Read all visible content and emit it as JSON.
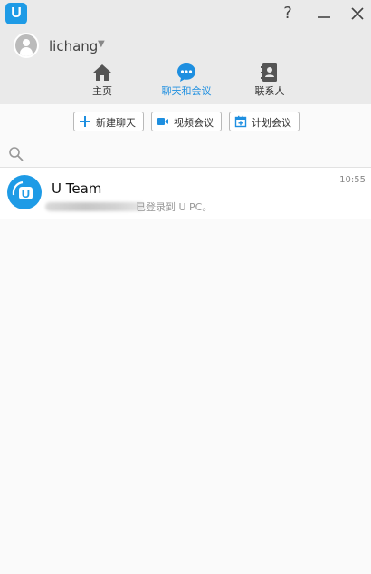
{
  "window": {
    "help_label": "?",
    "minimize_label": "—",
    "close_label": "✕"
  },
  "user": {
    "name": "lichang"
  },
  "nav": {
    "home": "主页",
    "chat": "聊天和会议",
    "contacts": "联系人",
    "active_color": "#1e8fe0"
  },
  "toolbar": {
    "new_chat": "新建聊天",
    "video_meeting": "视频会议",
    "schedule_meeting": "计划会议"
  },
  "search": {
    "placeholder": ""
  },
  "conversations": [
    {
      "name": "U Team",
      "time": "10:55",
      "preview": "已登录到 U PC。"
    }
  ],
  "colors": {
    "brand": "#1e9be6",
    "text_gray": "#999999"
  }
}
